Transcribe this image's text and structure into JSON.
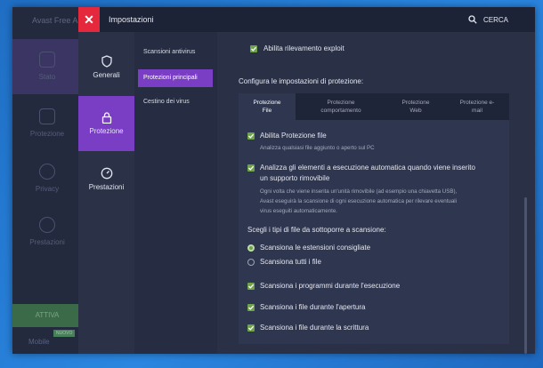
{
  "background_app": {
    "title": "Avast Free A",
    "items": [
      "Stato",
      "Protezione",
      "Privacy",
      "Prestazioni"
    ],
    "activate": "ATTIVA",
    "new_badge": "NUOVO",
    "mobile": "Mobile"
  },
  "topbar": {
    "title": "Impostazioni",
    "search": "CERCA"
  },
  "categories": [
    {
      "label": "Generali",
      "icon": "shield-icon"
    },
    {
      "label": "Protezione",
      "icon": "lock-icon"
    },
    {
      "label": "Prestazioni",
      "icon": "gauge-icon"
    }
  ],
  "subnav": [
    "Scansioni antivirus",
    "Protezioni principali",
    "Cestino dei virus"
  ],
  "main": {
    "exploit": "Abilita rilevamento exploit",
    "heading": "Configura le impostazioni di protezione:",
    "tabs": [
      {
        "l1": "Protezione",
        "l2": "File"
      },
      {
        "l1": "Protezione",
        "l2": "comportamento"
      },
      {
        "l1": "Protezione",
        "l2": "Web"
      },
      {
        "l1": "Protezione e-",
        "l2": "mail"
      }
    ],
    "enable_file": "Abilita Protezione file",
    "enable_file_desc": "Analizza qualsiasi file aggiunto o aperto sul PC",
    "autorun_l1": "Analizza gli elementi a esecuzione automatica quando viene inserito",
    "autorun_l2": "un supporto rimovibile",
    "autorun_desc1": "Ogni volta che viene inserita un'unità rimovibile (ad esempio una chiavetta USB),",
    "autorun_desc2": "Avast eseguirà la scansione di ogni esecuzione automatica per rilevare eventuali",
    "autorun_desc3": "virus eseguiti automaticamente.",
    "filetypes_heading": "Scegli i tipi di file da sottoporre a scansione:",
    "radio_recommended": "Scansiona le estensioni consigliate",
    "radio_all": "Scansiona tutti i file",
    "scan_exec": "Scansiona i programmi durante l'esecuzione",
    "scan_open": "Scansiona i file durante l'apertura",
    "scan_write": "Scansiona i file durante la scrittura"
  },
  "colors": {
    "accent": "#7a3ec4",
    "close": "#e5283b",
    "check": "#6fa34b"
  }
}
